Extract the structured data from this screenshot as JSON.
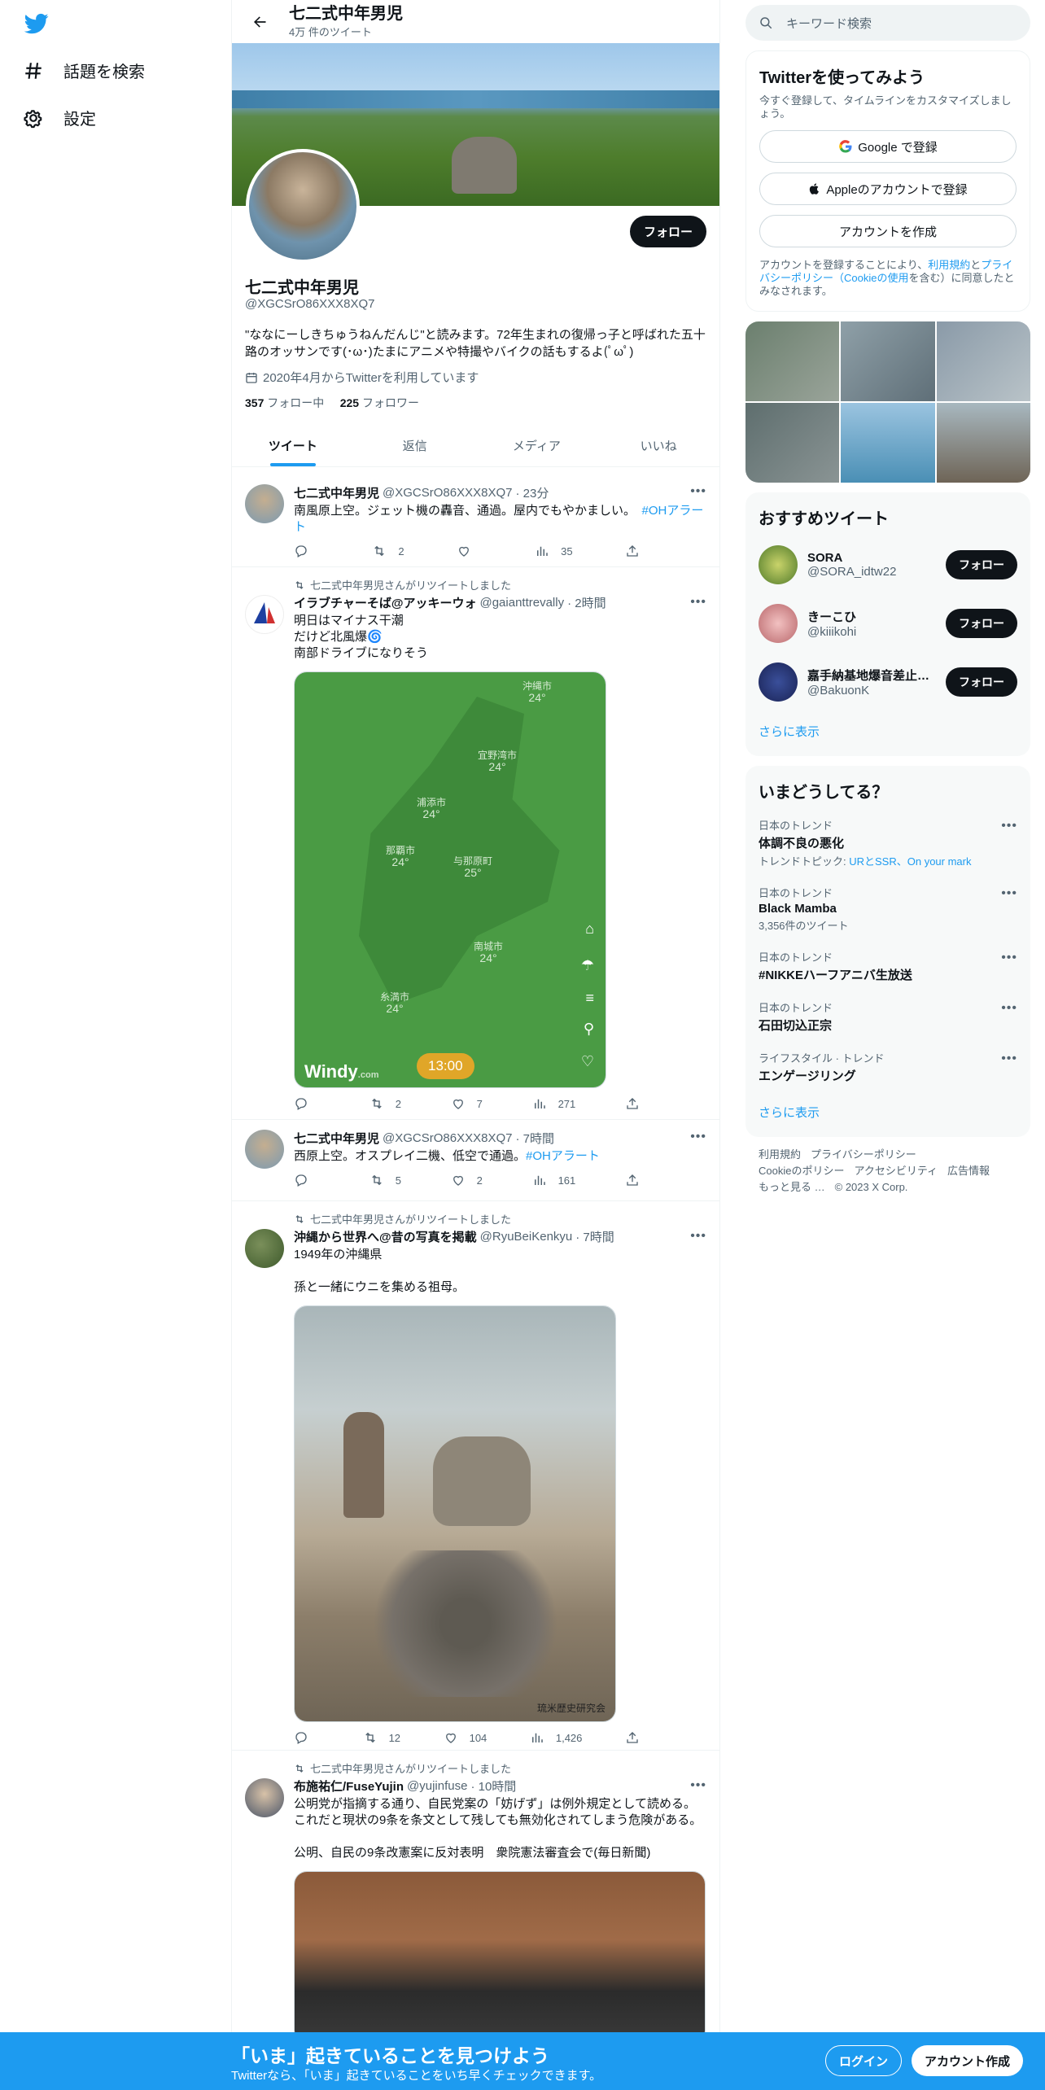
{
  "nav": {
    "explore": "話題を検索",
    "settings": "設定"
  },
  "header": {
    "title": "七二式中年男児",
    "tweet_count": "4万 件のツイート"
  },
  "profile": {
    "follow": "フォロー",
    "name": "七二式中年男児",
    "handle": "@XGCSrO86XXX8XQ7",
    "bio": "\"ななにーしきちゅうねんだんじ\"と読みます。72年生まれの復帰っ子と呼ばれた五十路のオッサンです(･ω･)たまにアニメや特撮やバイクの話もするよ(ﾟωﾟ)",
    "joined": "2020年4月からTwitterを利用しています",
    "following_count": "357",
    "following_label": "フォロー中",
    "followers_count": "225",
    "followers_label": "フォロワー"
  },
  "tabs": [
    "ツイート",
    "返信",
    "メディア",
    "いいね"
  ],
  "tweets": [
    {
      "name": "七二式中年男児",
      "handle": "@XGCSrO86XXX8XQ7",
      "time": "· 23分",
      "text": "南風原上空。ジェット機の轟音、通過。屋内でもやかましい。",
      "hashtag": "#OHアラート",
      "replies": "",
      "retweets": "2",
      "likes": "",
      "views": "35"
    },
    {
      "retweeted_by": "七二式中年男児さんがリツイートしました",
      "name": "イラブチャーそば@アッキーウォ",
      "handle": "@gaianttrevally",
      "time": "· 2時間",
      "text": "明日はマイナス干潮\nだけど北風爆🌀\n南部ドライブになりそう",
      "map": {
        "labels": [
          {
            "city": "沖縄市",
            "temp": "24°"
          },
          {
            "city": "宜野湾市",
            "temp": "24°"
          },
          {
            "city": "浦添市",
            "temp": "24°"
          },
          {
            "city": "那覇市",
            "temp": "24°"
          },
          {
            "city": "与那原町",
            "temp": "25°"
          },
          {
            "city": "南城市",
            "temp": "24°"
          },
          {
            "city": "糸満市",
            "temp": "24°"
          }
        ],
        "time": "13:00",
        "brand": "Windy",
        "brand_suffix": ".com"
      },
      "replies": "",
      "retweets": "2",
      "likes": "7",
      "views": "271"
    },
    {
      "name": "七二式中年男児",
      "handle": "@XGCSrO86XXX8XQ7",
      "time": "· 7時間",
      "text": "西原上空。オスプレイ二機、低空で通過。",
      "hashtag": "#OHアラート",
      "replies": "",
      "retweets": "5",
      "likes": "2",
      "views": "161"
    },
    {
      "retweeted_by": "七二式中年男児さんがリツイートしました",
      "name": "沖縄から世界へ@昔の写真を掲載",
      "handle": "@RyuBeiKenkyu",
      "time": "· 7時間",
      "text": "1949年の沖縄県\n\n孫と一緒にウニを集める祖母。",
      "photo_credit": "琉米歴史研究会",
      "replies": "",
      "retweets": "12",
      "likes": "104",
      "views": "1,426"
    },
    {
      "retweeted_by": "七二式中年男児さんがリツイートしました",
      "name": "布施祐仁/FuseYujin",
      "handle": "@yujinfuse",
      "time": "· 10時間",
      "text": "公明党が指摘する通り、自民党案の「妨げず」は例外規定として読める。これだと現状の9条を条文として残しても無効化されてしまう危険がある。\n\n公明、自民の9条改憲案に反対表明　衆院憲法審査会で(毎日新聞)"
    }
  ],
  "right": {
    "search_placeholder": "キーワード検索",
    "signup_card": {
      "title": "Twitterを使ってみよう",
      "subtitle": "今すぐ登録して、タイムラインをカスタマイズしましょう。",
      "google": "Google で登録",
      "apple": "Appleのアカウントで登録",
      "create": "アカウントを作成",
      "terms_1": "アカウントを登録することにより、",
      "terms_link1": "利用規約",
      "terms_2": "と",
      "terms_link2": "プライバシーポリシー（Cookieの使用",
      "terms_3": "を含む）に同意したとみなされます。"
    },
    "recommend": {
      "title": "おすすめツイート",
      "users": [
        {
          "name": "SORA",
          "handle": "@SORA_idtw22",
          "button": "フォロー"
        },
        {
          "name": "きーこひ",
          "handle": "@kiiikohi",
          "button": "フォロー"
        },
        {
          "name": "嘉手納基地爆音差止…",
          "handle": "@BakuonK",
          "button": "フォロー"
        }
      ],
      "more": "さらに表示"
    },
    "trends": {
      "title": "いまどうしてる？",
      "items": [
        {
          "context": "日本のトレンド",
          "name": "体調不良の悪化",
          "meta_label": "トレンドトピック: ",
          "meta_links": "URとSSR、On your mark"
        },
        {
          "context": "日本のトレンド",
          "name": "Black Mamba",
          "meta": "3,356件のツイート"
        },
        {
          "context": "日本のトレンド",
          "name": "#NIKKEハーフアニバ生放送"
        },
        {
          "context": "日本のトレンド",
          "name": "石田切込正宗"
        },
        {
          "context": "ライフスタイル · トレンド",
          "name": "エンゲージリング"
        }
      ],
      "more": "さらに表示"
    },
    "footer": [
      "利用規約",
      "プライバシーポリシー",
      "Cookieのポリシー",
      "アクセシビリティ",
      "広告情報",
      "もっと見る …",
      "© 2023 X Corp."
    ]
  },
  "bottom": {
    "title": "「いま」起きていることを見つけよう",
    "subtitle": "Twitterなら、「いま」起きていることをいち早くチェックできます。",
    "login": "ログイン",
    "signup": "アカウント作成"
  },
  "colors": {
    "accent": "#1d9bf0",
    "text": "#0f1419",
    "muted": "#536471"
  }
}
